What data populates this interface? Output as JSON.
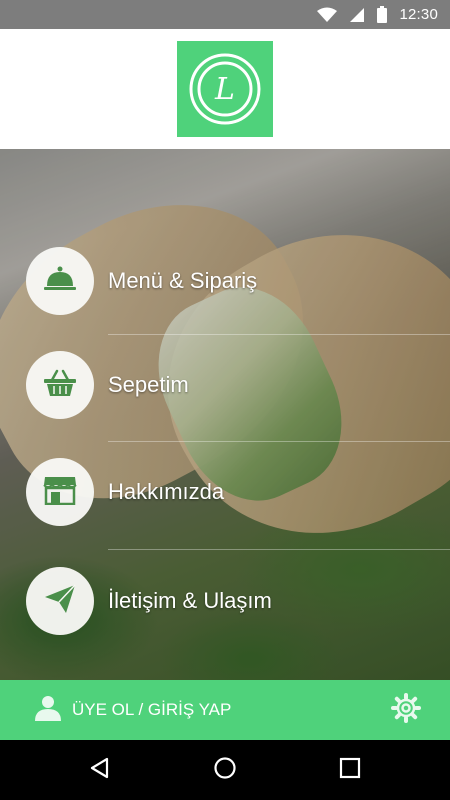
{
  "status_bar": {
    "time": "12:30",
    "icons": [
      "wifi-icon",
      "signal-icon",
      "battery-icon"
    ]
  },
  "header": {
    "logo_letter": "L",
    "logo_color": "#4fd27b"
  },
  "menu": {
    "items": [
      {
        "label": "Menü & Sipariş",
        "icon": "cloche-icon"
      },
      {
        "label": "Sepetim",
        "icon": "basket-icon"
      },
      {
        "label": "Hakkımızda",
        "icon": "store-icon"
      },
      {
        "label": "İletişim & Ulaşım",
        "icon": "paper-plane-icon"
      }
    ]
  },
  "bottom_bar": {
    "login_label": "ÜYE OL / GİRİŞ YAP",
    "accent": "#4fd27b",
    "icons": [
      "user-icon",
      "gear-icon"
    ]
  },
  "nav_bar": {
    "icons": [
      "back-icon",
      "home-icon",
      "recents-icon"
    ]
  }
}
